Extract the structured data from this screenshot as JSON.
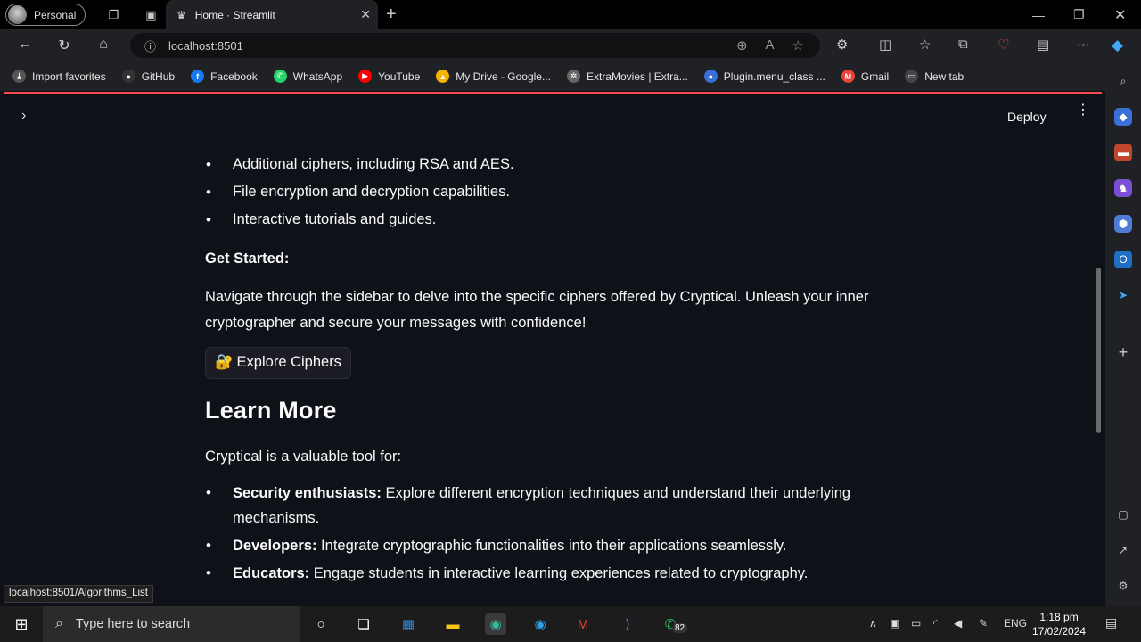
{
  "browser": {
    "profile_label": "Personal",
    "tab_title": "Home · Streamlit",
    "address": "localhost:8501",
    "bookmarks": [
      {
        "label": "Import favorites",
        "color": "#555555",
        "glyph": "⤓"
      },
      {
        "label": "GitHub",
        "color": "#333333",
        "glyph": "●"
      },
      {
        "label": "Facebook",
        "color": "#1877f2",
        "glyph": "f"
      },
      {
        "label": "WhatsApp",
        "color": "#25d366",
        "glyph": "✆"
      },
      {
        "label": "YouTube",
        "color": "#ff0000",
        "glyph": "▶"
      },
      {
        "label": "My Drive - Google...",
        "color": "#f4b400",
        "glyph": "▲"
      },
      {
        "label": "ExtraMovies | Extra...",
        "color": "#666666",
        "glyph": "✲"
      },
      {
        "label": "Plugin.menu_class ...",
        "color": "#3b6fd8",
        "glyph": "●"
      },
      {
        "label": "Gmail",
        "color": "#ea4335",
        "glyph": "M"
      },
      {
        "label": "New tab",
        "color": "#444444",
        "glyph": "▭"
      }
    ]
  },
  "app": {
    "deploy_label": "Deploy",
    "features": [
      "Additional ciphers, including RSA and AES.",
      "File encryption and decryption capabilities.",
      "Interactive tutorials and guides."
    ],
    "get_started_heading": "Get Started:",
    "get_started_text": "Navigate through the sidebar to delve into the specific ciphers offered by Cryptical. Unleash your inner cryptographer and secure your messages with confidence!",
    "explore_button": {
      "emoji": "🔐",
      "label": "Explore Ciphers"
    },
    "learn_more_heading": "Learn More",
    "learn_more_intro": "Cryptical is a valuable tool for:",
    "audiences": [
      {
        "bold": "Security enthusiasts:",
        "text": " Explore different encryption techniques and understand their underlying mechanisms."
      },
      {
        "bold": "Developers:",
        "text": " Integrate cryptographic functionalities into their applications seamlessly."
      },
      {
        "bold": "Educators:",
        "text": " Engage students in interactive learning experiences related to cryptography."
      }
    ]
  },
  "status_url": "localhost:8501/Algorithms_List",
  "taskbar": {
    "search_placeholder": "Type here to search",
    "whatsapp_badge": "82",
    "language": "ENG",
    "time": "1:18 pm",
    "date": "17/02/2024"
  }
}
